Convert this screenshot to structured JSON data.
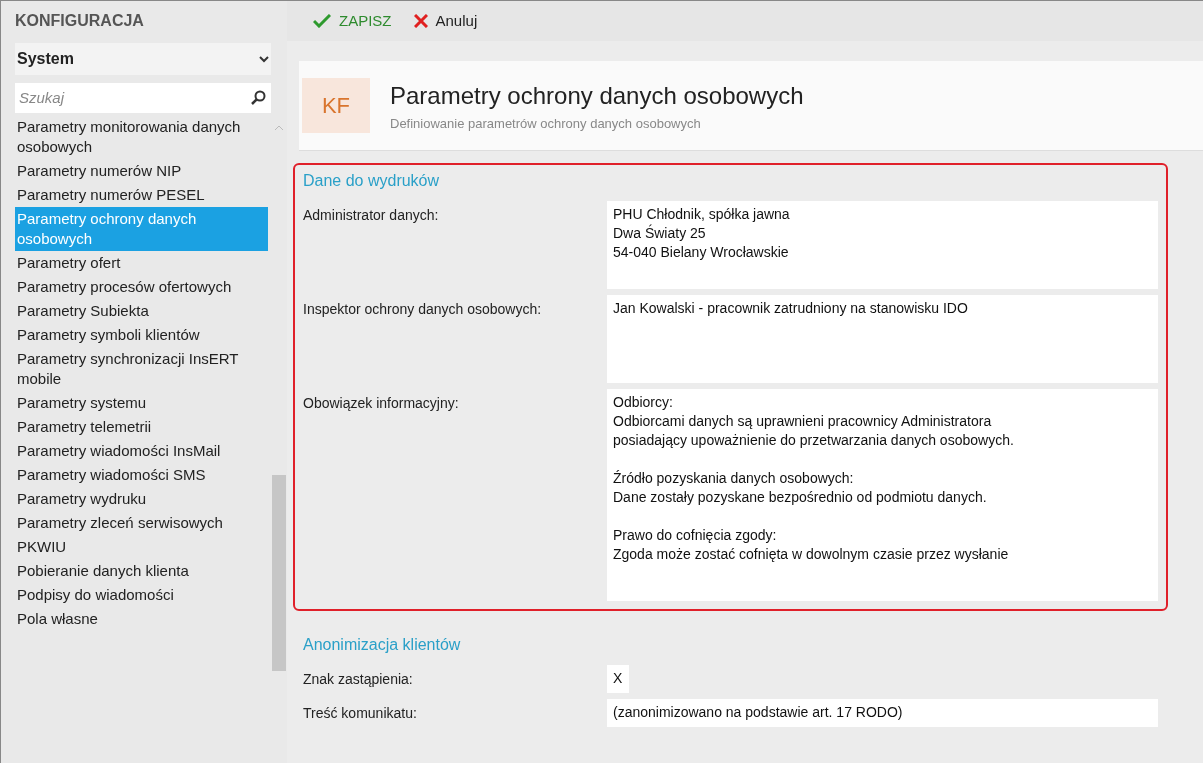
{
  "sidebar": {
    "title": "KONFIGURACJA",
    "category": {
      "value": "System"
    },
    "search": {
      "placeholder": "Szukaj"
    },
    "items": [
      {
        "label": "Parametry monitorowania danych osobowych",
        "selected": false
      },
      {
        "label": "Parametry numerów NIP",
        "selected": false
      },
      {
        "label": "Parametry numerów PESEL",
        "selected": false
      },
      {
        "label": "Parametry ochrony danych osobowych",
        "selected": true
      },
      {
        "label": "Parametry ofert",
        "selected": false
      },
      {
        "label": "Parametry procesów ofertowych",
        "selected": false
      },
      {
        "label": "Parametry Subiekta",
        "selected": false
      },
      {
        "label": "Parametry symboli klientów",
        "selected": false
      },
      {
        "label": "Parametry synchronizacji InsERT mobile",
        "selected": false
      },
      {
        "label": "Parametry systemu",
        "selected": false
      },
      {
        "label": "Parametry telemetrii",
        "selected": false
      },
      {
        "label": "Parametry wiadomości InsMail",
        "selected": false
      },
      {
        "label": "Parametry wiadomości SMS",
        "selected": false
      },
      {
        "label": "Parametry wydruku",
        "selected": false
      },
      {
        "label": "Parametry zleceń serwisowych",
        "selected": false
      },
      {
        "label": "PKWIU",
        "selected": false
      },
      {
        "label": "Pobieranie danych klienta",
        "selected": false
      },
      {
        "label": "Podpisy do wiadomości",
        "selected": false
      },
      {
        "label": "Pola własne",
        "selected": false
      }
    ]
  },
  "toolbar": [
    {
      "kind": "save",
      "label": "ZAPISZ"
    },
    {
      "kind": "cancel",
      "label": "Anuluj"
    }
  ],
  "header": {
    "badge": "KF",
    "title": "Parametry ochrony danych osobowych",
    "subtitle": "Definiowanie parametrów ochrony danych osobowych"
  },
  "sections": [
    {
      "title": "Dane do wydruków",
      "highlighted": true,
      "fields": [
        {
          "label": "Administrator danych:",
          "kind": "multiline",
          "value": "PHU Chłodnik, spółka jawna\nDwa Światy 25\n54-040 Bielany Wrocławskie"
        },
        {
          "label": "Inspektor ochrony danych osobowych:",
          "kind": "multiline",
          "value": "Jan Kowalski - pracownik zatrudniony na stanowisku IDO"
        },
        {
          "label": "Obowiązek informacyjny:",
          "kind": "long",
          "value": "Odbiorcy:\nOdbiorcami danych są uprawnieni pracownicy Administratora\nposiadający upoważnienie do przetwarzania danych osobowych.\n\nŹródło pozyskania danych osobowych:\nDane zostały pozyskane bezpośrednio od podmiotu danych.\n\nPrawo do cofnięcia zgody:\nZgoda może zostać cofnięta w dowolnym czasie przez wysłanie"
        }
      ]
    },
    {
      "title": "Anonimizacja klientów",
      "highlighted": false,
      "fields": [
        {
          "label": "Znak zastąpienia:",
          "kind": "char",
          "value": "X"
        },
        {
          "label": "Treść komunikatu:",
          "kind": "line",
          "value": "(zanonimizowano na podstawie art. 17 RODO)"
        }
      ]
    }
  ]
}
